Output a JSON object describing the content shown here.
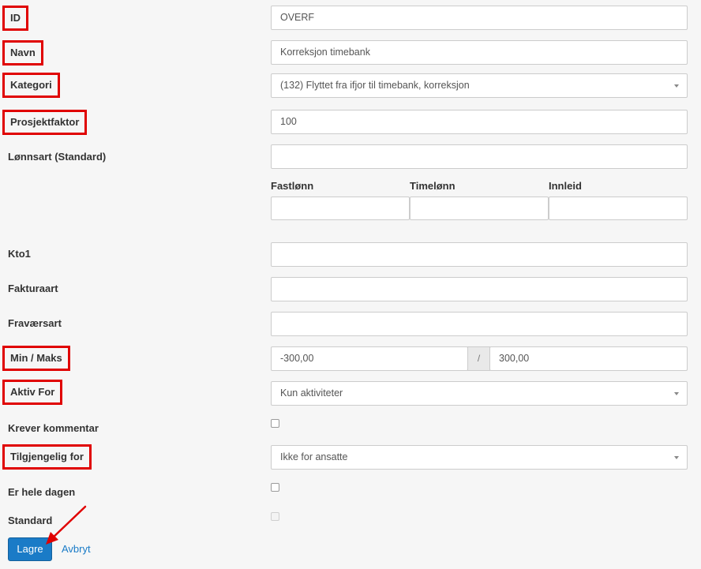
{
  "form": {
    "id": {
      "label": "ID",
      "value": "OVERF"
    },
    "navn": {
      "label": "Navn",
      "value": "Korreksjon timebank"
    },
    "kategori": {
      "label": "Kategori",
      "value": "(132) Flyttet fra ifjor til timebank, korreksjon"
    },
    "prosjektfaktor": {
      "label": "Prosjektfaktor",
      "value": "100"
    },
    "lonnsart": {
      "label": "Lønnsart (Standard)",
      "value": "",
      "fastlonn": {
        "label": "Fastlønn",
        "value": ""
      },
      "timelonn": {
        "label": "Timelønn",
        "value": ""
      },
      "innleid": {
        "label": "Innleid",
        "value": ""
      }
    },
    "kto1": {
      "label": "Kto1",
      "value": ""
    },
    "fakturaart": {
      "label": "Fakturaart",
      "value": ""
    },
    "fravaersart": {
      "label": "Fraværsart",
      "value": ""
    },
    "min_maks": {
      "label": "Min / Maks",
      "min": "-300,00",
      "separator": "/",
      "max": "300,00"
    },
    "aktiv_for": {
      "label": "Aktiv For",
      "value": "Kun aktiviteter"
    },
    "krever_kommentar": {
      "label": "Krever kommentar",
      "checked": false
    },
    "tilgjengelig_for": {
      "label": "Tilgjengelig for",
      "value": "Ikke for ansatte"
    },
    "er_hele_dagen": {
      "label": "Er hele dagen",
      "checked": false
    },
    "standard": {
      "label": "Standard",
      "checked": false,
      "disabled": true
    }
  },
  "actions": {
    "save_label": "Lagre",
    "cancel_label": "Avbryt"
  },
  "colors": {
    "highlight": "#e00000",
    "primary": "#1a7bc7"
  }
}
